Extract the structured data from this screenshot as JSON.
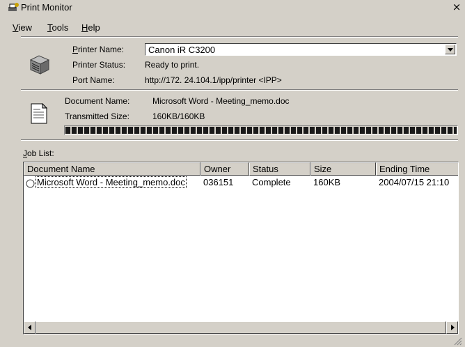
{
  "window": {
    "title": "Print Monitor",
    "close_glyph": "×"
  },
  "menu": [
    {
      "label": "View",
      "accel": "V",
      "rest": "iew"
    },
    {
      "label": "Tools",
      "accel": "T",
      "rest": "ools"
    },
    {
      "label": "Help",
      "accel": "H",
      "rest": "elp"
    }
  ],
  "printer": {
    "name_label_accel": "P",
    "name_label_rest": "rinter Name:",
    "name_value": "Canon iR C3200",
    "status_label": "Printer Status:",
    "status_value": "Ready to print.",
    "port_label": "Port Name:",
    "port_value": "http://172. 24.104.1/ipp/printer <IPP>"
  },
  "document": {
    "name_label": "Document Name:",
    "name_value": "Microsoft Word - Meeting_memo.doc",
    "size_label": "Transmitted Size:",
    "size_value": "160KB/160KB",
    "progress": 1.0
  },
  "job_list": {
    "label_accel": "J",
    "label_rest": "ob List:",
    "columns": [
      "Document Name",
      "Owner",
      "Status",
      "Size",
      "Ending Time"
    ],
    "rows": [
      [
        "Microsoft Word - Meeting_memo.doc",
        "036151",
        "Complete",
        "160KB",
        "2004/07/15 21:10"
      ]
    ]
  },
  "icons": [
    "printer-app-icon",
    "printer-icon",
    "document-icon",
    "dropdown-arrow-icon",
    "scroll-left-icon",
    "scroll-right-icon",
    "resize-grip-icon"
  ],
  "colors": {
    "face": "#d4d0c8",
    "shadow": "#808080",
    "list_bg": "#ffffff",
    "progress": "#1a1a1a"
  }
}
